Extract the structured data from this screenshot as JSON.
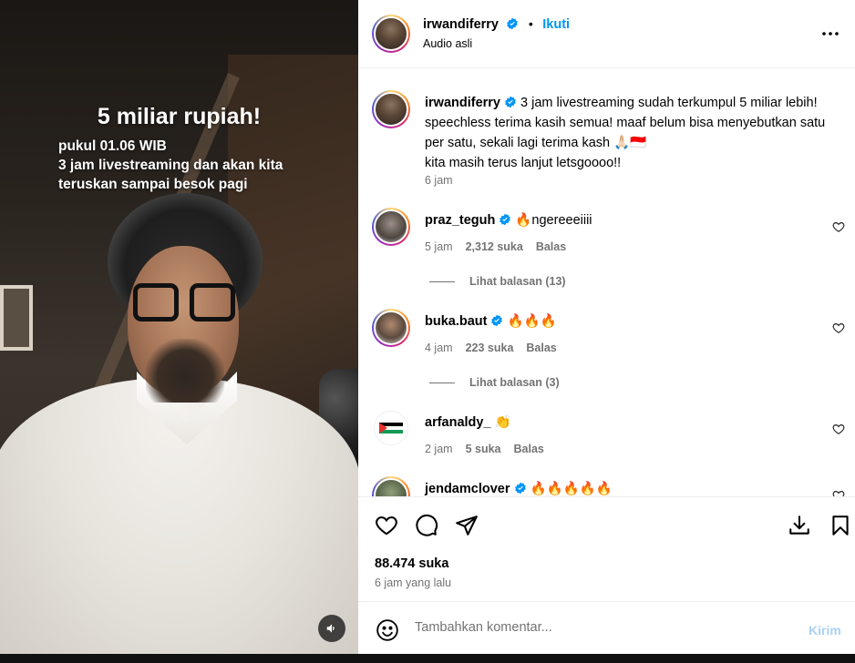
{
  "video": {
    "caption_title": "5 miliar rupiah!",
    "caption_lines": [
      "pukul 01.06 WIB",
      "3 jam livestreaming dan akan kita",
      "teruskan sampai besok pagi"
    ],
    "sound_icon": "speaker-icon"
  },
  "header": {
    "username": "irwandiferry",
    "follow_label": "Ikuti",
    "separator": "•",
    "subtitle": "Audio asli",
    "more_icon": "more-options-icon"
  },
  "caption": {
    "username": "irwandiferry",
    "lines": [
      "3 jam livestreaming sudah terkumpul 5 miliar lebih!",
      "speechless terima kasih semua! maaf belum bisa menyebutkan satu",
      "per satu, sekali lagi terima kash 🙏🏻🇮🇩",
      "kita masih terus lanjut letsgoooo!!"
    ],
    "time": "6 jam"
  },
  "comments": [
    {
      "username": "praz_teguh",
      "verified": true,
      "text": "🔥ngereeeiiii",
      "time": "5 jam",
      "likes": "2,312 suka",
      "reply": "Balas",
      "view_replies": "Lihat balasan (13)"
    },
    {
      "username": "buka.baut",
      "verified": true,
      "text": "🔥🔥🔥",
      "time": "4 jam",
      "likes": "223 suka",
      "reply": "Balas",
      "view_replies": "Lihat balasan (3)"
    },
    {
      "username": "arfanaldy_",
      "verified": false,
      "text": "👏",
      "time": "2 jam",
      "likes": "5 suka",
      "reply": "Balas",
      "view_replies": ""
    },
    {
      "username": "jendamclover",
      "verified": true,
      "text": "🔥🔥🔥🔥🔥",
      "time": "",
      "likes": "",
      "reply": "",
      "view_replies": ""
    }
  ],
  "actions": {
    "likes_count": "88.474 suka",
    "posted_ago": "6 jam yang lalu",
    "icons": [
      "heart-icon",
      "comment-icon",
      "share-icon",
      "save-download-icon",
      "bookmark-icon"
    ]
  },
  "add_comment": {
    "placeholder": "Tambahkan komentar...",
    "post_label": "Kirim"
  },
  "colors": {
    "accent": "#0095f6",
    "muted": "#737373",
    "post_disabled": "#a8d2f7"
  }
}
